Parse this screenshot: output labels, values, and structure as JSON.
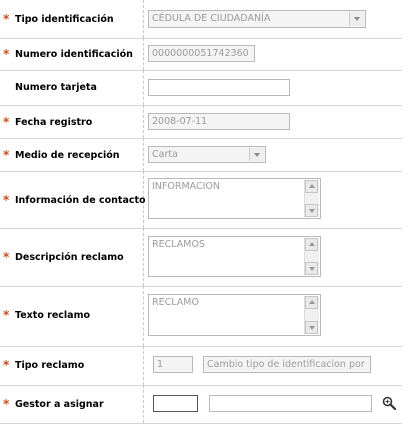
{
  "required_marker": "*",
  "colors": {
    "required": "#d24a1a",
    "label": "#000000",
    "value": "#9b9b9b",
    "border": "#b9b9b9"
  },
  "fields": {
    "tipo_identificacion": {
      "label": "Tipo identificación",
      "value": "CÉDULA DE CIUDADANÍA",
      "required": true
    },
    "numero_identificacion": {
      "label": "Numero identificación",
      "value": "0000000051742360",
      "required": true
    },
    "numero_tarjeta": {
      "label": "Numero tarjeta",
      "value": "",
      "required": false
    },
    "fecha_registro": {
      "label": "Fecha registro",
      "value": "2008-07-11",
      "required": true
    },
    "medio_recepcion": {
      "label": "Medio de recepción",
      "value": "Carta",
      "required": true
    },
    "informacion_contacto": {
      "label": "Información de contacto",
      "value": "INFORMACION",
      "required": true
    },
    "descripcion_reclamo": {
      "label": "Descripción reclamo",
      "value": "RECLAMOS",
      "required": true
    },
    "texto_reclamo": {
      "label": "Texto reclamo",
      "value": "RECLAMO",
      "required": true
    },
    "tipo_reclamo": {
      "label": "Tipo reclamo",
      "code": "1",
      "description": "Cambio tipo de identificacion por",
      "required": true
    },
    "gestor_asignar": {
      "label": "Gestor a asignar",
      "code": "",
      "name": "",
      "required": true,
      "icon": "magnifier-icon"
    }
  }
}
